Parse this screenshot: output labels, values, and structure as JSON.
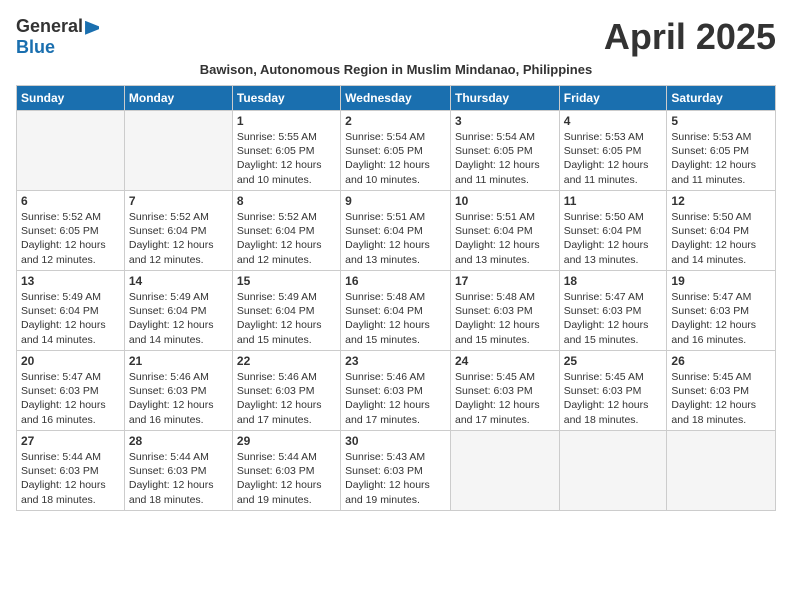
{
  "header": {
    "logo_general": "General",
    "logo_blue": "Blue",
    "month_title": "April 2025",
    "subtitle": "Bawison, Autonomous Region in Muslim Mindanao, Philippines"
  },
  "weekdays": [
    "Sunday",
    "Monday",
    "Tuesday",
    "Wednesday",
    "Thursday",
    "Friday",
    "Saturday"
  ],
  "weeks": [
    [
      {
        "day": "",
        "info": ""
      },
      {
        "day": "",
        "info": ""
      },
      {
        "day": "1",
        "info": "Sunrise: 5:55 AM\nSunset: 6:05 PM\nDaylight: 12 hours and 10 minutes."
      },
      {
        "day": "2",
        "info": "Sunrise: 5:54 AM\nSunset: 6:05 PM\nDaylight: 12 hours and 10 minutes."
      },
      {
        "day": "3",
        "info": "Sunrise: 5:54 AM\nSunset: 6:05 PM\nDaylight: 12 hours and 11 minutes."
      },
      {
        "day": "4",
        "info": "Sunrise: 5:53 AM\nSunset: 6:05 PM\nDaylight: 12 hours and 11 minutes."
      },
      {
        "day": "5",
        "info": "Sunrise: 5:53 AM\nSunset: 6:05 PM\nDaylight: 12 hours and 11 minutes."
      }
    ],
    [
      {
        "day": "6",
        "info": "Sunrise: 5:52 AM\nSunset: 6:05 PM\nDaylight: 12 hours and 12 minutes."
      },
      {
        "day": "7",
        "info": "Sunrise: 5:52 AM\nSunset: 6:04 PM\nDaylight: 12 hours and 12 minutes."
      },
      {
        "day": "8",
        "info": "Sunrise: 5:52 AM\nSunset: 6:04 PM\nDaylight: 12 hours and 12 minutes."
      },
      {
        "day": "9",
        "info": "Sunrise: 5:51 AM\nSunset: 6:04 PM\nDaylight: 12 hours and 13 minutes."
      },
      {
        "day": "10",
        "info": "Sunrise: 5:51 AM\nSunset: 6:04 PM\nDaylight: 12 hours and 13 minutes."
      },
      {
        "day": "11",
        "info": "Sunrise: 5:50 AM\nSunset: 6:04 PM\nDaylight: 12 hours and 13 minutes."
      },
      {
        "day": "12",
        "info": "Sunrise: 5:50 AM\nSunset: 6:04 PM\nDaylight: 12 hours and 14 minutes."
      }
    ],
    [
      {
        "day": "13",
        "info": "Sunrise: 5:49 AM\nSunset: 6:04 PM\nDaylight: 12 hours and 14 minutes."
      },
      {
        "day": "14",
        "info": "Sunrise: 5:49 AM\nSunset: 6:04 PM\nDaylight: 12 hours and 14 minutes."
      },
      {
        "day": "15",
        "info": "Sunrise: 5:49 AM\nSunset: 6:04 PM\nDaylight: 12 hours and 15 minutes."
      },
      {
        "day": "16",
        "info": "Sunrise: 5:48 AM\nSunset: 6:04 PM\nDaylight: 12 hours and 15 minutes."
      },
      {
        "day": "17",
        "info": "Sunrise: 5:48 AM\nSunset: 6:03 PM\nDaylight: 12 hours and 15 minutes."
      },
      {
        "day": "18",
        "info": "Sunrise: 5:47 AM\nSunset: 6:03 PM\nDaylight: 12 hours and 15 minutes."
      },
      {
        "day": "19",
        "info": "Sunrise: 5:47 AM\nSunset: 6:03 PM\nDaylight: 12 hours and 16 minutes."
      }
    ],
    [
      {
        "day": "20",
        "info": "Sunrise: 5:47 AM\nSunset: 6:03 PM\nDaylight: 12 hours and 16 minutes."
      },
      {
        "day": "21",
        "info": "Sunrise: 5:46 AM\nSunset: 6:03 PM\nDaylight: 12 hours and 16 minutes."
      },
      {
        "day": "22",
        "info": "Sunrise: 5:46 AM\nSunset: 6:03 PM\nDaylight: 12 hours and 17 minutes."
      },
      {
        "day": "23",
        "info": "Sunrise: 5:46 AM\nSunset: 6:03 PM\nDaylight: 12 hours and 17 minutes."
      },
      {
        "day": "24",
        "info": "Sunrise: 5:45 AM\nSunset: 6:03 PM\nDaylight: 12 hours and 17 minutes."
      },
      {
        "day": "25",
        "info": "Sunrise: 5:45 AM\nSunset: 6:03 PM\nDaylight: 12 hours and 18 minutes."
      },
      {
        "day": "26",
        "info": "Sunrise: 5:45 AM\nSunset: 6:03 PM\nDaylight: 12 hours and 18 minutes."
      }
    ],
    [
      {
        "day": "27",
        "info": "Sunrise: 5:44 AM\nSunset: 6:03 PM\nDaylight: 12 hours and 18 minutes."
      },
      {
        "day": "28",
        "info": "Sunrise: 5:44 AM\nSunset: 6:03 PM\nDaylight: 12 hours and 18 minutes."
      },
      {
        "day": "29",
        "info": "Sunrise: 5:44 AM\nSunset: 6:03 PM\nDaylight: 12 hours and 19 minutes."
      },
      {
        "day": "30",
        "info": "Sunrise: 5:43 AM\nSunset: 6:03 PM\nDaylight: 12 hours and 19 minutes."
      },
      {
        "day": "",
        "info": ""
      },
      {
        "day": "",
        "info": ""
      },
      {
        "day": "",
        "info": ""
      }
    ]
  ]
}
